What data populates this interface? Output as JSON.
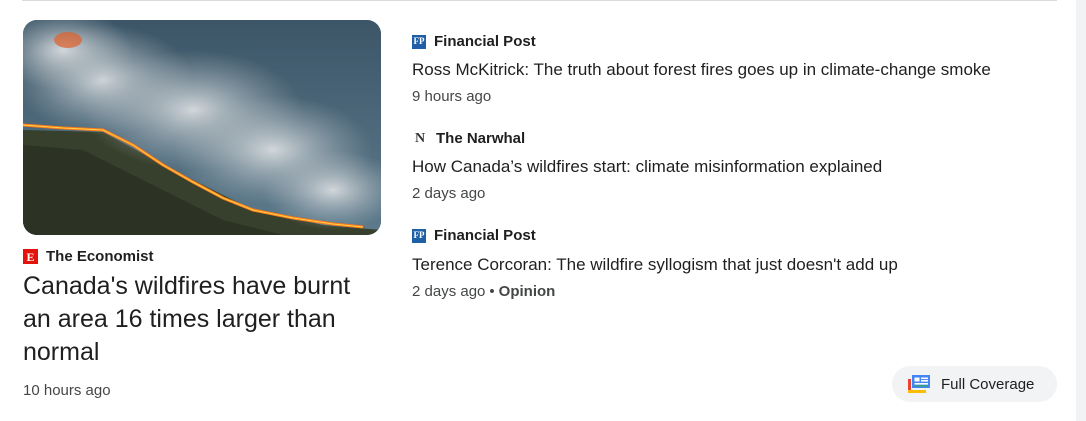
{
  "hero": {
    "image_alt": "aerial-wildfire-photo",
    "source": {
      "name": "The Economist",
      "logo_text": "E",
      "logo_color": "#e3120b"
    },
    "headline": "Canada's wildfires have burnt an area 16 times larger than normal",
    "time": "10 hours ago"
  },
  "articles": [
    {
      "source": {
        "name": "Financial Post",
        "logo_text": "FP",
        "logo_color": "#1f5fa8"
      },
      "headline": "Ross McKitrick: The truth about forest fires goes up in climate-change smoke",
      "time": "9 hours ago"
    },
    {
      "source": {
        "name": "The Narwhal",
        "logo_text": "N"
      },
      "headline": "How Canada’s wildfires start: climate misinformation explained",
      "time": "2 days ago"
    },
    {
      "source": {
        "name": "Financial Post",
        "logo_text": "FP",
        "logo_color": "#1f5fa8"
      },
      "headline": "Terence Corcoran: The wildfire syllogism that just doesn't add up",
      "time": "2 days ago",
      "separator": "•",
      "label": "Opinion"
    }
  ],
  "full_coverage": {
    "label": "Full Coverage",
    "icon": "full-coverage-icon"
  }
}
